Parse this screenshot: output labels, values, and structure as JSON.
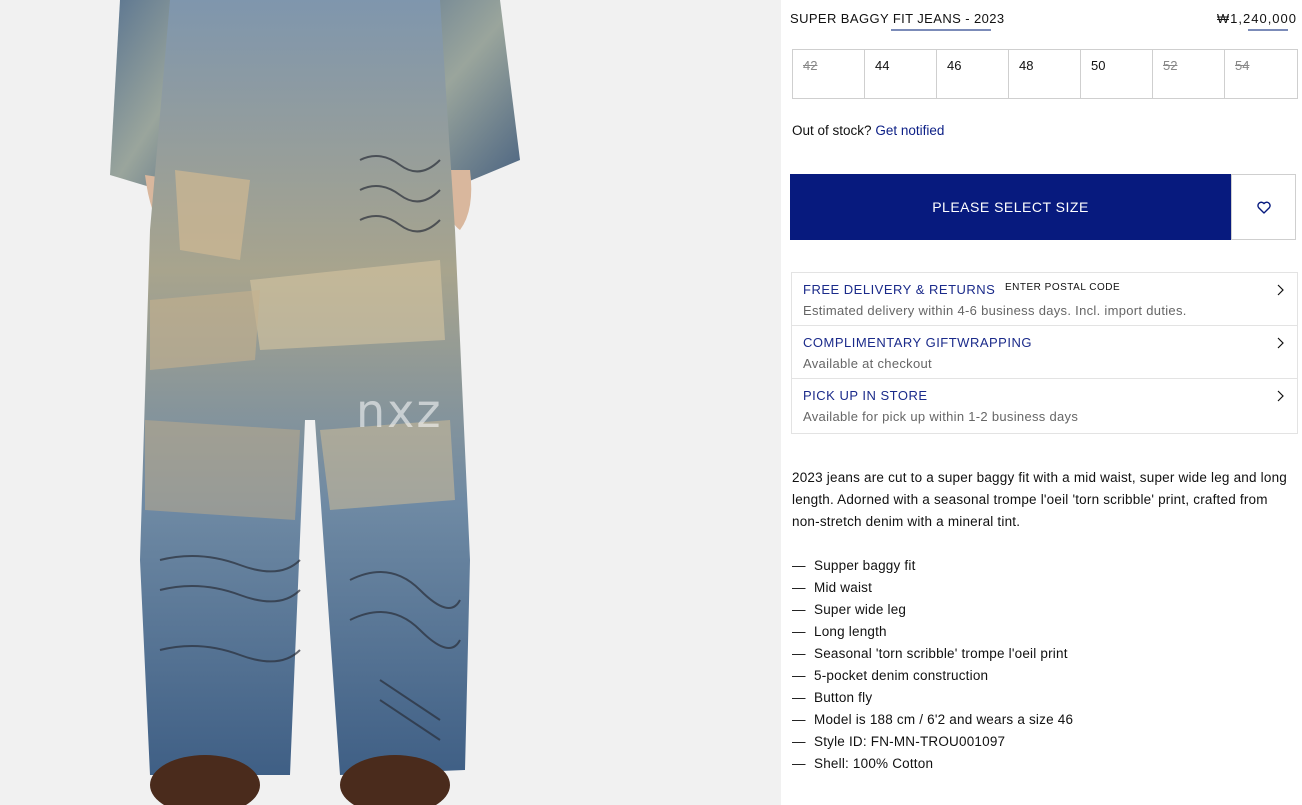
{
  "product": {
    "title": "SUPER BAGGY FIT JEANS - 2023",
    "price": "₩1,240,000",
    "image_watermark": "nxz"
  },
  "sizes": [
    {
      "label": "42",
      "available": false
    },
    {
      "label": "44",
      "available": true
    },
    {
      "label": "46",
      "available": true
    },
    {
      "label": "48",
      "available": true
    },
    {
      "label": "50",
      "available": true
    },
    {
      "label": "52",
      "available": false
    },
    {
      "label": "54",
      "available": false
    }
  ],
  "stock": {
    "out_of_stock_text": "Out of stock?",
    "notify_link": "Get notified"
  },
  "cta": {
    "primary_label": "PLEASE SELECT SIZE",
    "wishlist_icon": "heart-icon"
  },
  "services": [
    {
      "title": "FREE DELIVERY & RETURNS",
      "link": "ENTER POSTAL CODE",
      "subtitle": "Estimated delivery within 4-6 business days. Incl. import duties."
    },
    {
      "title": "COMPLIMENTARY GIFTWRAPPING",
      "subtitle": "Available at checkout"
    },
    {
      "title": "PICK UP IN STORE",
      "subtitle": "Available for pick up within 1-2 business days"
    }
  ],
  "description": "2023 jeans are cut to a super baggy fit with a mid waist, super wide leg and long length. Adorned with a seasonal trompe l'oeil 'torn scribble' print, crafted from non-stretch denim with a mineral tint.",
  "features": [
    "Supper baggy fit",
    "Mid waist",
    "Super wide leg",
    "Long length",
    "Seasonal 'torn scribble' trompe l'oeil print",
    "5-pocket denim construction",
    "Button fly",
    "Model is 188 cm / 6'2 and wears a size 46",
    "Style ID: FN-MN-TROU001097",
    "Shell: 100% Cotton"
  ],
  "colors": {
    "accent": "#071a7e",
    "link": "#0c1f86",
    "service_title": "#1a2a8a"
  }
}
